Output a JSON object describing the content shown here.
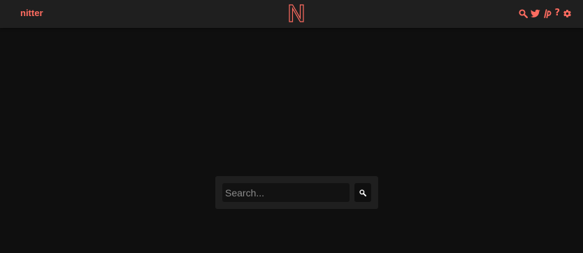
{
  "header": {
    "site_name": "nitter",
    "logo_letter": "N",
    "icons": [
      "search-icon",
      "twitter-bird-icon",
      "rss-icon",
      "help-icon",
      "gear-icon"
    ],
    "help_glyph": "?"
  },
  "search": {
    "placeholder": "Search...",
    "value": ""
  },
  "colors": {
    "accent": "#ff6c60",
    "background": "#0f0f0f",
    "navbar": "#1f1f1f",
    "panel": "#1f1f1f",
    "input": "#121212"
  }
}
